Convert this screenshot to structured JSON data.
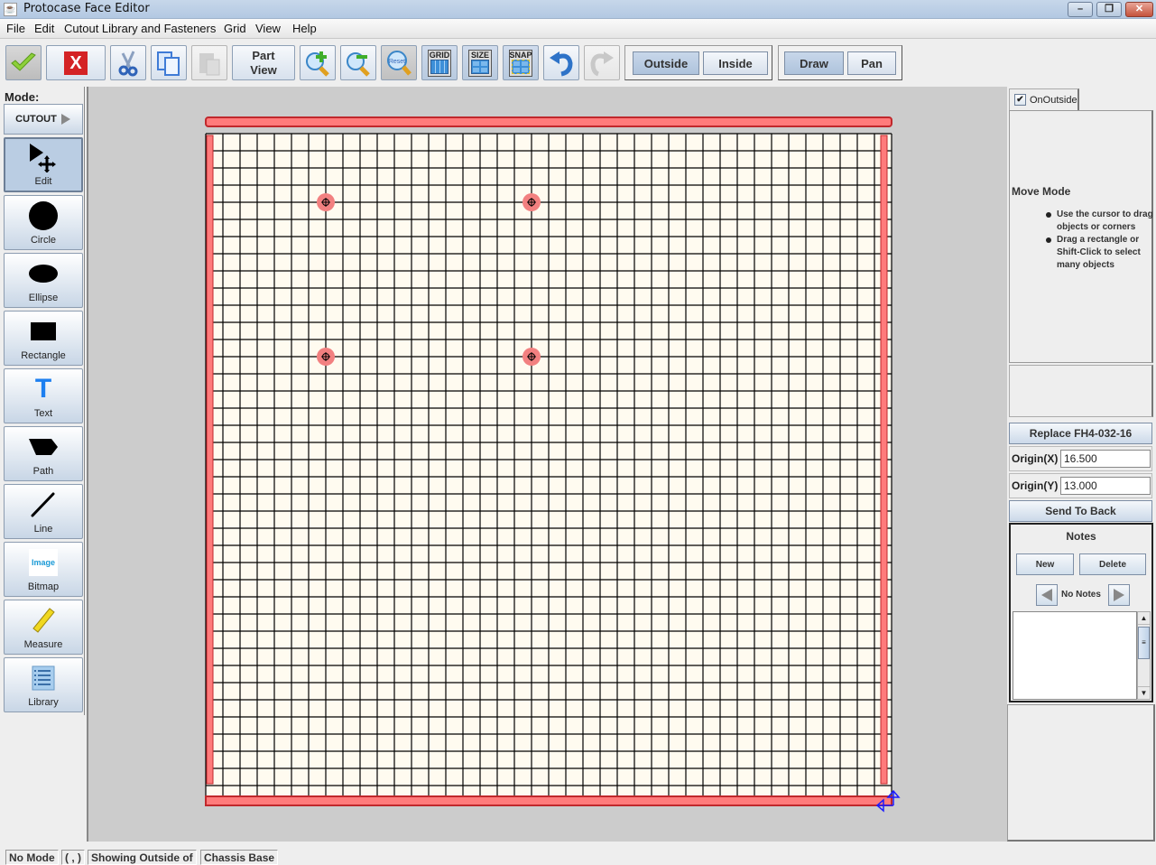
{
  "window": {
    "title": "Protocase Face Editor",
    "controls": [
      "minimize",
      "restore",
      "close"
    ]
  },
  "menu": [
    "File",
    "Edit",
    "Cutout Library and Fasteners",
    "Grid",
    "View",
    "Help"
  ],
  "toolbar": {
    "accept": {
      "icon": "checkmark-icon",
      "tooltip": ""
    },
    "cancel": {
      "icon": "red-x-icon",
      "label": "X"
    },
    "cut": {
      "icon": "scissors-icon"
    },
    "copy": {
      "icon": "copy-icon"
    },
    "paste": {
      "icon": "paste-icon",
      "enabled": false
    },
    "part_view": "Part\nView",
    "part_view_line1": "Part",
    "part_view_line2": "View",
    "zoom_in": {
      "icon": "zoom-in-icon"
    },
    "zoom_out": {
      "icon": "zoom-out-icon"
    },
    "zoom_reset": {
      "icon": "zoom-reset-icon",
      "label": "Reset"
    },
    "grid": {
      "label": "GRID",
      "pressed": true
    },
    "size": {
      "label": "SIZE",
      "pressed": true
    },
    "snap": {
      "label": "SNAP",
      "pressed": true
    },
    "undo": {
      "icon": "undo-icon",
      "enabled": true
    },
    "redo": {
      "icon": "redo-icon",
      "enabled": false
    },
    "side_group": {
      "options": [
        "Outside",
        "Inside"
      ],
      "selected": "Outside"
    },
    "tool_group": {
      "options": [
        "Draw",
        "Pan"
      ],
      "selected": "Draw"
    }
  },
  "palette": {
    "mode_label": "Mode:",
    "cutout_label": "CUTOUT",
    "tools": [
      {
        "label": "Edit",
        "icon": "edit-move-icon",
        "selected": true
      },
      {
        "label": "Circle",
        "icon": "circle-icon",
        "selected": false
      },
      {
        "label": "Ellipse",
        "icon": "ellipse-icon",
        "selected": false
      },
      {
        "label": "Rectangle",
        "icon": "rectangle-icon",
        "selected": false
      },
      {
        "label": "Text",
        "icon": "text-icon",
        "selected": false
      },
      {
        "label": "Path",
        "icon": "path-icon",
        "selected": false
      },
      {
        "label": "Line",
        "icon": "line-icon",
        "selected": false
      },
      {
        "label": "Bitmap",
        "icon": "bitmap-icon",
        "icon_text": "Image",
        "selected": false
      },
      {
        "label": "Measure",
        "icon": "ruler-icon",
        "selected": false
      },
      {
        "label": "Library",
        "icon": "library-icon",
        "selected": false
      }
    ]
  },
  "canvas": {
    "colors": {
      "background": "#cccccc",
      "face": "#fffbf0",
      "grid_line": "#000000",
      "flange": "#ff7b7b",
      "flange_edge": "#c0282c",
      "hole": "#f28080",
      "axis": "#1c1cff"
    },
    "grid_columns": 40,
    "grid_rows": 40,
    "holes": [
      {
        "col": 7,
        "row": 4
      },
      {
        "col": 19,
        "row": 4
      },
      {
        "col": 7,
        "row": 13
      },
      {
        "col": 19,
        "row": 13
      }
    ]
  },
  "right_panel": {
    "tab": {
      "label": "OnOutside",
      "checked": true
    },
    "move_mode": {
      "title": "Move Mode",
      "hints": [
        "Use the cursor to drag objects or corners",
        "Drag a rectangle or Shift-Click to select many objects"
      ]
    },
    "replace_button": "Replace FH4-032-16",
    "origin_x": {
      "label": "Origin(X)",
      "value": "16.500"
    },
    "origin_y": {
      "label": "Origin(Y)",
      "value": "13.000"
    },
    "send_to_back": "Send To Back",
    "notes": {
      "title": "Notes",
      "new_label": "New",
      "delete_label": "Delete",
      "status": "No Notes",
      "text": ""
    }
  },
  "statusbar": {
    "mode": "No Mode",
    "coords": "( , )",
    "showing": "Showing Outside of",
    "face": "Chassis Base"
  }
}
